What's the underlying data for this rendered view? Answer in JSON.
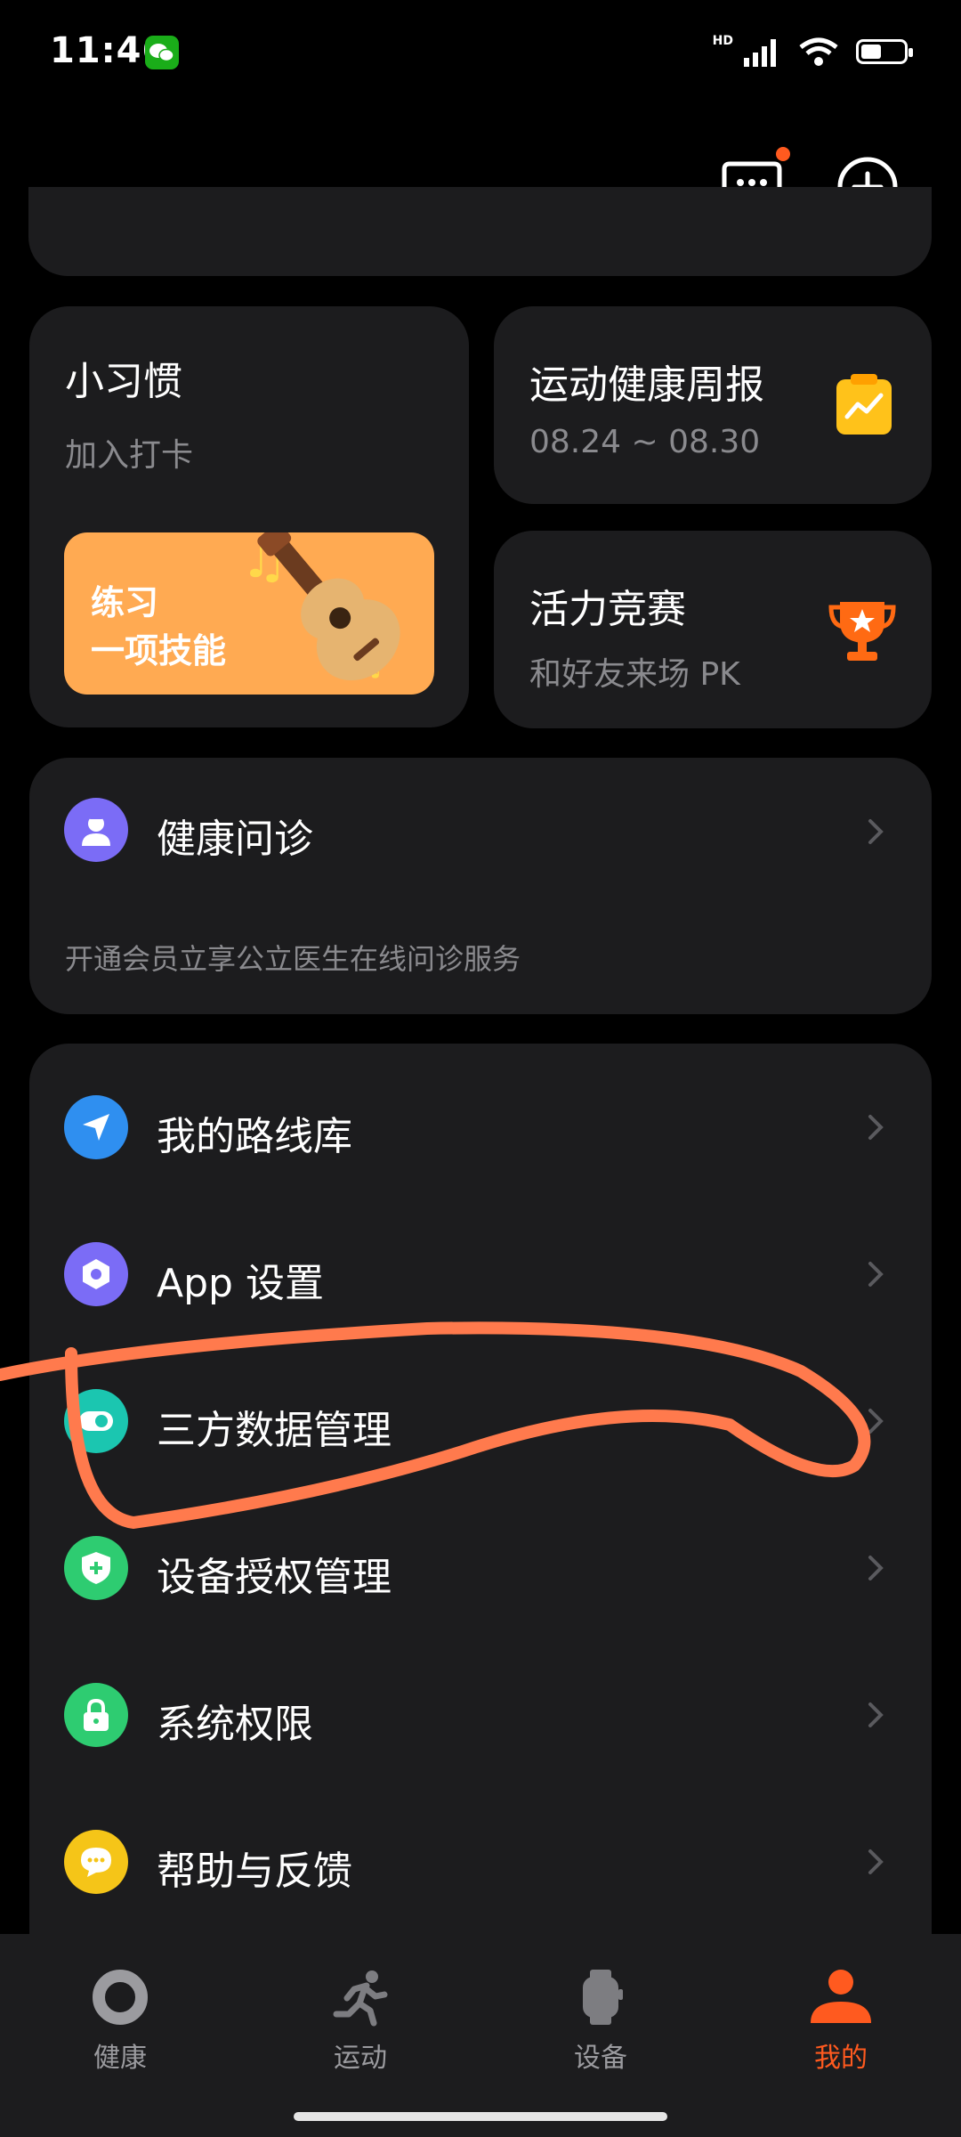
{
  "status_bar": {
    "time": "11:46",
    "network": "HD",
    "wifi_sub": "6"
  },
  "header": {
    "message_icon": "message-icon",
    "add_icon": "add-icon",
    "badge_color": "#ff5a1f"
  },
  "habit_card": {
    "title": "小习惯",
    "subtitle": "加入打卡",
    "banner_text_line1": "练习",
    "banner_text_line2": "一项技能"
  },
  "weekly_card": {
    "title": "运动健康周报",
    "date_range": "08.24 ~ 08.30"
  },
  "race_card": {
    "title": "活力竞赛",
    "subtitle": "和好友来场 PK"
  },
  "consult_card": {
    "title": "健康问诊",
    "note": "开通会员立享公立医生在线问诊服务"
  },
  "menu": {
    "items": [
      {
        "label": "我的路线库",
        "icon": "navigation-icon",
        "color": "#2f8ff0"
      },
      {
        "label": "App 设置",
        "icon": "settings-icon",
        "color": "#7b6cf6"
      },
      {
        "label": "三方数据管理",
        "icon": "toggle-icon",
        "color": "#1bc6b0"
      },
      {
        "label": "设备授权管理",
        "icon": "shield-icon",
        "color": "#2ecc71"
      },
      {
        "label": "系统权限",
        "icon": "lock-icon",
        "color": "#2ecc71"
      },
      {
        "label": "帮助与反馈",
        "icon": "chat-icon",
        "color": "#f5c518"
      }
    ]
  },
  "tabs": [
    {
      "label": "健康",
      "icon": "ring-icon",
      "active": false
    },
    {
      "label": "运动",
      "icon": "running-icon",
      "active": false
    },
    {
      "label": "设备",
      "icon": "watch-icon",
      "active": false
    },
    {
      "label": "我的",
      "icon": "profile-icon",
      "active": true
    }
  ],
  "colors": {
    "accent": "#ff5a1f",
    "card": "#1c1c1e",
    "annotation": "#ff7a4d"
  }
}
